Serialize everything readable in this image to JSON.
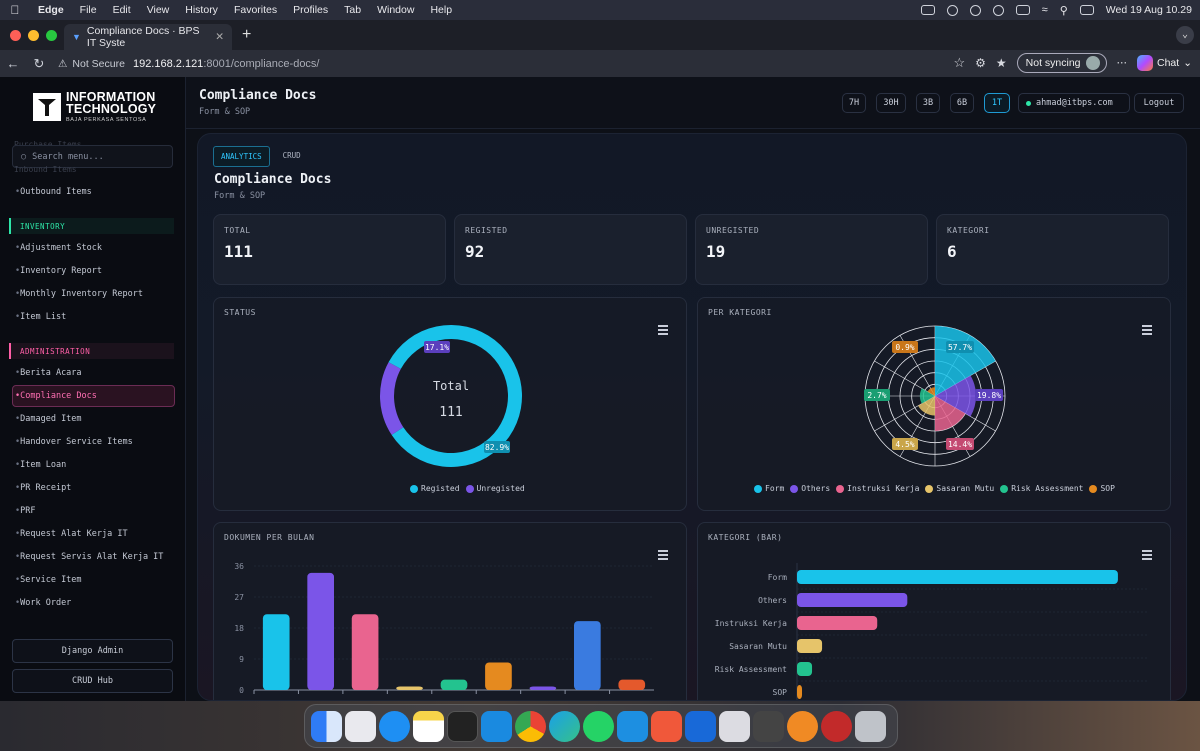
{
  "os_menubar": {
    "app": "Edge",
    "items": [
      "File",
      "Edit",
      "View",
      "History",
      "Favorites",
      "Profiles",
      "Tab",
      "Window",
      "Help"
    ],
    "datetime": "Wed 19 Aug  10.29"
  },
  "browser": {
    "tab_title": "Compliance Docs · BPS IT Syste",
    "security": "Not Secure",
    "url_host": "192.168.2.121",
    "url_path": ":8001/compliance-docs/",
    "sync_label": "Not syncing",
    "chat_label": "Chat"
  },
  "logo": {
    "line1": "INFORMATION",
    "line2": "TECHNOLOGY",
    "line3": "BAJA PERKASA SENTOSA"
  },
  "sidebar": {
    "ghost_top": "Purchase Items",
    "ghost_bottom": "Inbound Items",
    "search_placeholder": "Search menu...",
    "outbound": "Outbound Items",
    "section_inventory": "INVENTORY",
    "inventory_items": [
      "Adjustment Stock",
      "Inventory Report",
      "Monthly Inventory Report",
      "Item List"
    ],
    "section_admin": "ADMINISTRATION",
    "admin_items": [
      "Berita Acara",
      "Compliance Docs",
      "Damaged Item",
      "Handover Service Items",
      "Item Loan",
      "PR Receipt",
      "PRF",
      "Request Alat Kerja IT",
      "Request Servis Alat Kerja IT",
      "Service Item",
      "Work Order"
    ],
    "django_admin": "Django Admin",
    "crud_hub": "CRUD Hub"
  },
  "header": {
    "title": "Compliance Docs",
    "subtitle": "Form & SOP",
    "periods": [
      "7H",
      "30H",
      "3B",
      "6B",
      "1T"
    ],
    "active_period": "1T",
    "email": "ahmad@itbps.com",
    "logout": "Logout"
  },
  "main": {
    "tabs": [
      "ANALYTICS",
      "CRUD"
    ],
    "title": "Compliance Docs",
    "subtitle": "Form & SOP",
    "kpis": [
      {
        "label": "TOTAL",
        "value": "111"
      },
      {
        "label": "REGISTED",
        "value": "92"
      },
      {
        "label": "UNREGISTED",
        "value": "19"
      },
      {
        "label": "KATEGORI",
        "value": "6"
      }
    ],
    "status_panel": {
      "title": "STATUS",
      "center_label": "Total",
      "center_value": "111",
      "label_big": "82.9%",
      "label_small": "17.1%",
      "legend": [
        "Registed",
        "Unregisted"
      ]
    },
    "category_panel": {
      "title": "PER KATEGORI",
      "labels": [
        "57.7%",
        "19.8%",
        "14.4%",
        "4.5%",
        "2.7%",
        "0.9%"
      ],
      "legend": [
        "Form",
        "Others",
        "Instruksi Kerja",
        "Sasaran Mutu",
        "Risk Assessment",
        "SOP"
      ]
    },
    "monthly_panel": {
      "title": "DOKUMEN PER BULAN",
      "yticks": [
        "36",
        "27",
        "18",
        "9",
        "0"
      ]
    },
    "bar_panel": {
      "title": "KATEGORI (BAR)"
    }
  },
  "colors": {
    "cyan": "#19c3ea",
    "purple": "#7b55e8",
    "pink": "#e9648f",
    "yellow": "#e6c46a",
    "green": "#23c38f",
    "orange": "#e58a1f",
    "blue": "#3a7be0",
    "red": "#e4592c"
  },
  "chart_data": [
    {
      "type": "pie",
      "title": "STATUS",
      "categories": [
        "Registed",
        "Unregisted"
      ],
      "values": [
        92,
        19
      ],
      "percent_labels": [
        "82.9%",
        "17.1%"
      ]
    },
    {
      "type": "pie",
      "title": "PER KATEGORI",
      "categories": [
        "Form",
        "Others",
        "Instruksi Kerja",
        "Sasaran Mutu",
        "Risk Assessment",
        "SOP"
      ],
      "values": [
        57.7,
        19.8,
        14.4,
        4.5,
        2.7,
        0.9
      ]
    },
    {
      "type": "bar",
      "title": "DOKUMEN PER BULAN",
      "values": [
        22,
        34,
        22,
        1,
        3,
        8,
        1,
        20,
        3
      ],
      "ylim": [
        0,
        36
      ],
      "yticks": [
        0,
        9,
        18,
        27,
        36
      ]
    },
    {
      "type": "bar",
      "title": "KATEGORI (BAR)",
      "orientation": "horizontal",
      "categories": [
        "Form",
        "Others",
        "Instruksi Kerja",
        "Sasaran Mutu",
        "Risk Assessment",
        "SOP"
      ],
      "values": [
        64,
        22,
        16,
        5,
        3,
        1
      ]
    }
  ]
}
